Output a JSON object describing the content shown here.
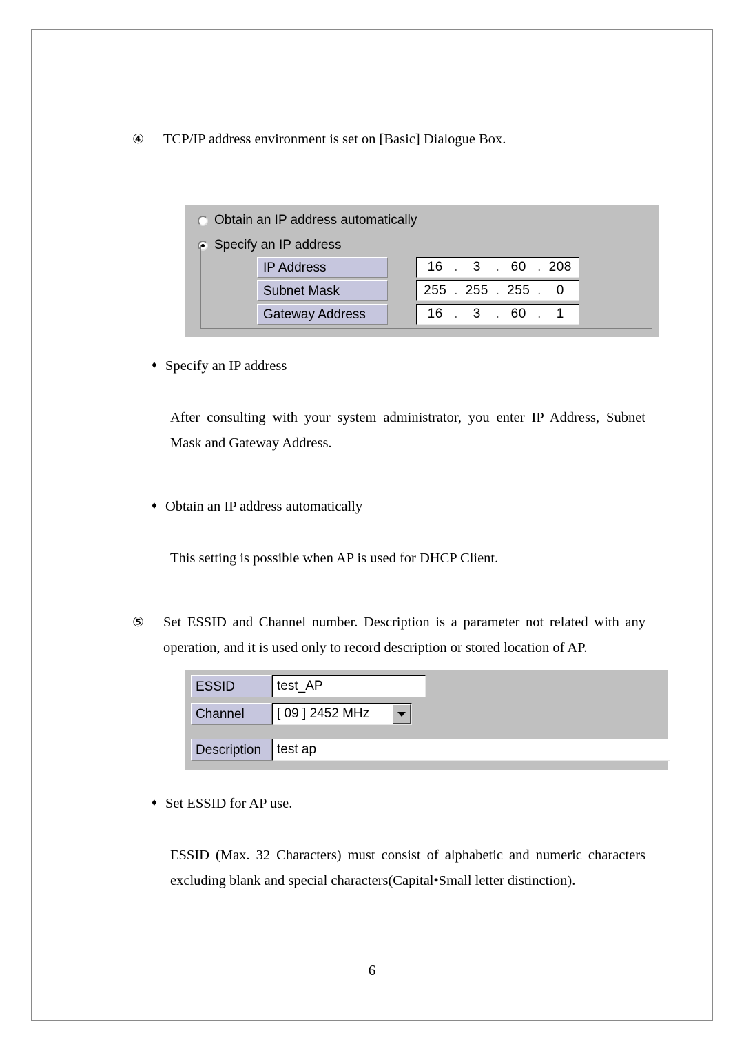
{
  "document": {
    "page_number": "6"
  },
  "steps": {
    "step4": {
      "number": "④",
      "text": "TCP/IP address environment is set on [Basic] Dialogue Box."
    },
    "step5": {
      "number": "⑤",
      "text": "Set ESSID and Channel number. Description is a parameter not related with any operation, and it is used only to record description or stored location of AP."
    }
  },
  "bullets": {
    "marker": "♦",
    "specify_ip": {
      "heading": "Specify an IP address",
      "body": "After consulting with your system administrator, you enter IP Address, Subnet Mask and Gateway Address."
    },
    "obtain_ip": {
      "heading": "Obtain an IP address automatically",
      "body": "This setting is possible when AP is used for DHCP Client."
    },
    "set_essid": {
      "heading": "Set ESSID for AP use.",
      "body": "ESSID (Max. 32 Characters) must consist of alphabetic and numeric characters excluding blank and special characters(Capital•Small letter distinction)."
    }
  },
  "dialog_tcpip": {
    "radio_obtain": {
      "label": "Obtain an IP address automatically",
      "checked": false
    },
    "radio_specify": {
      "label": "Specify an IP address",
      "checked": true
    },
    "fields": [
      {
        "label": "IP Address",
        "octets": [
          "16",
          "3",
          "60",
          "208"
        ]
      },
      {
        "label": "Subnet Mask",
        "octets": [
          "255",
          "255",
          "255",
          "0"
        ]
      },
      {
        "label": "Gateway Address",
        "octets": [
          "16",
          "3",
          "60",
          "1"
        ]
      }
    ],
    "separator": "."
  },
  "dialog_essid": {
    "essid": {
      "label": "ESSID",
      "value": "test_AP"
    },
    "channel": {
      "label": "Channel",
      "value": "[ 09 ] 2452 MHz"
    },
    "description": {
      "label": "Description",
      "value": "test ap"
    }
  },
  "colors": {
    "dialog_face": "#c0c0c0",
    "label_fill": "#c6c6de",
    "field_fill": "#ffffff",
    "page_border": "#8a8a8a"
  }
}
